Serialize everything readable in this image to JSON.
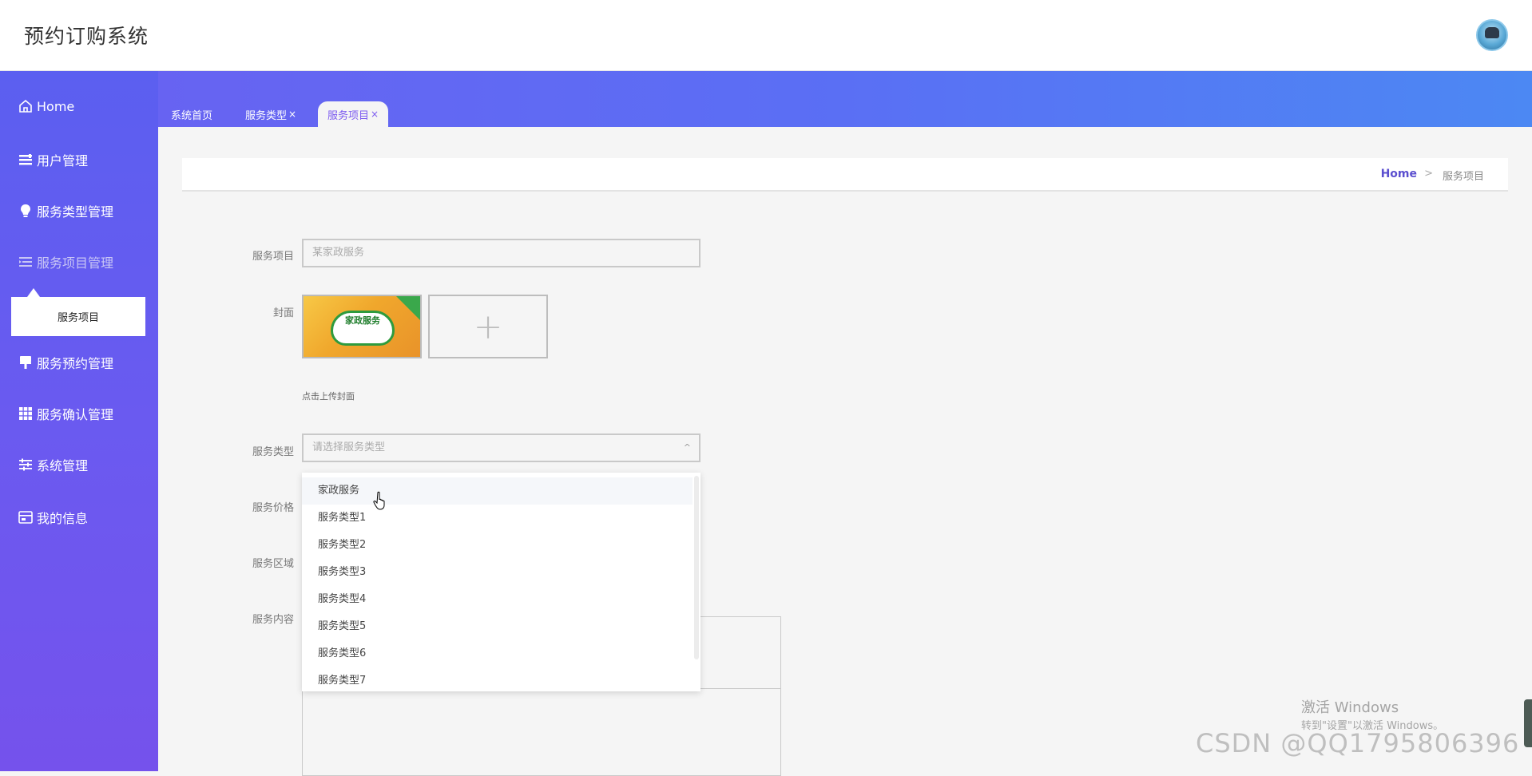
{
  "header": {
    "title": "预约订购系统"
  },
  "sidebar": {
    "items": [
      {
        "label": "Home",
        "icon": "home-icon"
      },
      {
        "label": "用户管理",
        "icon": "list-icon"
      },
      {
        "label": "服务类型管理",
        "icon": "bulb-icon"
      },
      {
        "label": "服务项目管理",
        "icon": "indent-icon"
      },
      {
        "label": "服务预约管理",
        "icon": "brush-icon"
      },
      {
        "label": "服务确认管理",
        "icon": "grid-icon"
      },
      {
        "label": "系统管理",
        "icon": "sliders-icon"
      },
      {
        "label": "我的信息",
        "icon": "card-icon"
      }
    ],
    "submenu_label": "服务项目"
  },
  "tabs": [
    {
      "label": "系统首页",
      "closable": false
    },
    {
      "label": "服务类型",
      "closable": true
    },
    {
      "label": "服务项目",
      "closable": true,
      "active": true
    }
  ],
  "tab_close_glyph": "×",
  "breadcrumb": {
    "home": "Home",
    "separator": ">",
    "current": "服务项目"
  },
  "form": {
    "service_item_label": "服务项目",
    "service_item_value": "某家政服务",
    "cover_label": "封面",
    "cover_image_text": "家政服务",
    "upload_plus": "+",
    "cover_hint": "点击上传封面",
    "service_type_label": "服务类型",
    "service_type_placeholder": "请选择服务类型",
    "service_type_arrow": "^",
    "price_label": "服务价格",
    "area_label": "服务区域",
    "content_label": "服务内容"
  },
  "dropdown": {
    "options": [
      "家政服务",
      "服务类型1",
      "服务类型2",
      "服务类型3",
      "服务类型4",
      "服务类型5",
      "服务类型6",
      "服务类型7"
    ],
    "hovered_index": 0
  },
  "watermark": {
    "line1": "激活 Windows",
    "line2": "转到\"设置\"以激活 Windows。",
    "csdn": "CSDN @QQ1795806396"
  },
  "colors": {
    "sidebar_top": "#5b5ff0",
    "sidebar_bottom": "#7552ec",
    "tab_active_text": "#7c5af0",
    "breadcrumb_home": "#5b4fcf"
  }
}
